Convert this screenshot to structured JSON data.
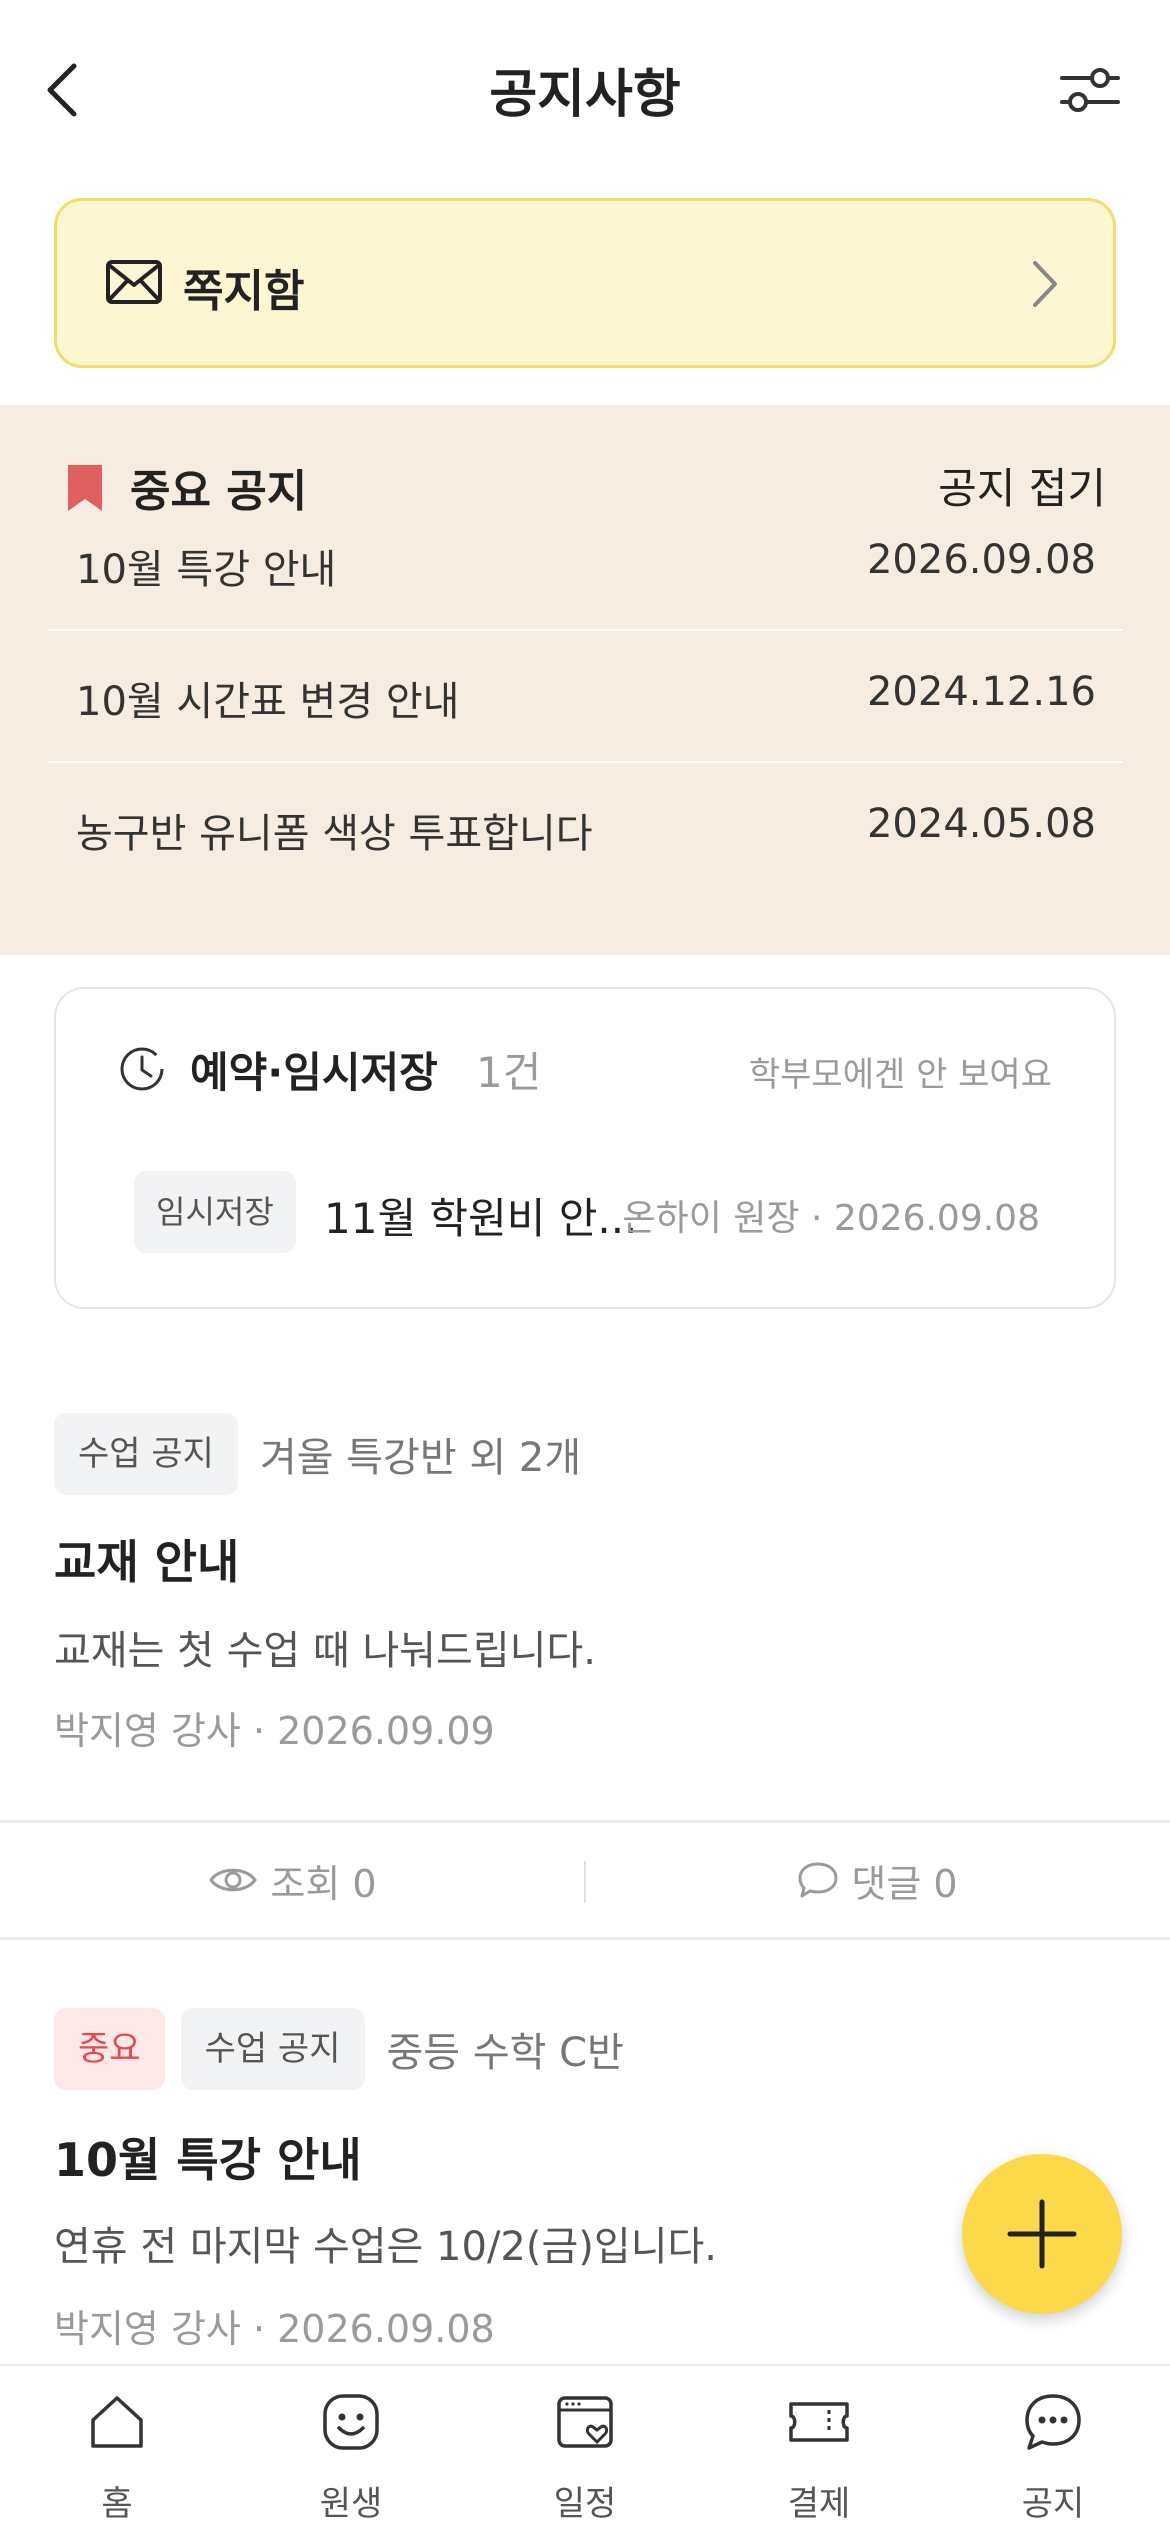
{
  "header": {
    "title": "공지사항",
    "back_icon": "chevron-left-icon",
    "filter_icon": "sliders-icon"
  },
  "message_box": {
    "label": "쪽지함",
    "icon": "envelope-icon"
  },
  "important": {
    "title": "중요 공지",
    "fold_label": "공지 접기",
    "flag_color": "#e06060",
    "items": [
      {
        "title": "10월 특강 안내",
        "date": "2026.09.08"
      },
      {
        "title": "10월 시간표 변경 안내",
        "date": "2024.12.16"
      },
      {
        "title": "농구반 유니폼 색상 투표합니다",
        "date": "2024.05.08"
      }
    ]
  },
  "reservation": {
    "title": "예약·임시저장",
    "count": "1건",
    "hint": "학부모에겐 안 보여요",
    "item": {
      "tag": "임시저장",
      "title": "11월 학원비 안...",
      "meta": "온하이 원장 · 2026.09.08"
    }
  },
  "notices": [
    {
      "tags": [
        "수업 공지"
      ],
      "target": "겨울 특강반  외 2개",
      "title": "교재 안내",
      "body": "교재는 첫 수업 때 나눠드립니다.",
      "meta": "박지영 강사 · 2026.09.09",
      "views_label": "조회 0",
      "comments_label": "댓글 0"
    },
    {
      "important_tag": "중요",
      "tags": [
        "수업 공지"
      ],
      "target": "중등 수학 C반",
      "title": "10월 특강 안내",
      "body": "연휴 전 마지막 수업은 10/2(금)입니다.",
      "meta": "박지영 강사 · 2026.09.08"
    }
  ],
  "fab": {
    "icon": "plus-icon",
    "color": "#fcd94a"
  },
  "bottom_nav": [
    {
      "label": "홈",
      "icon": "home-icon"
    },
    {
      "label": "원생",
      "icon": "smiley-icon"
    },
    {
      "label": "일정",
      "icon": "calendar-heart-icon"
    },
    {
      "label": "결제",
      "icon": "ticket-icon"
    },
    {
      "label": "공지",
      "icon": "chat-bubble-icon"
    }
  ]
}
